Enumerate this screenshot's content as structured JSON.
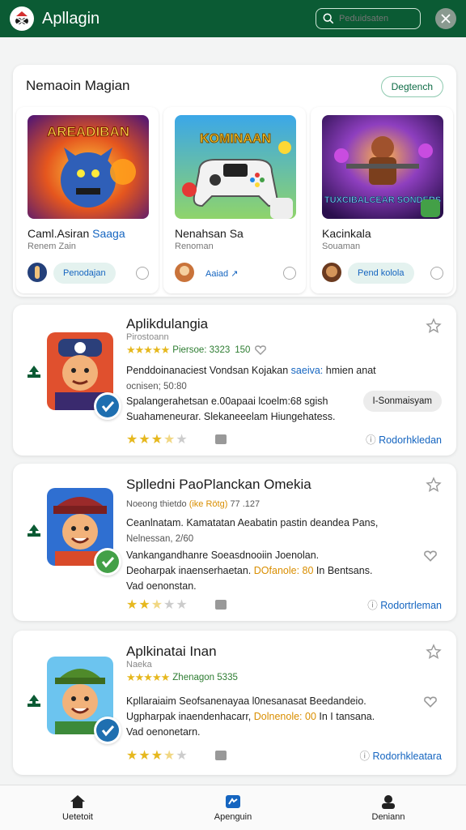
{
  "header": {
    "app_title": "Apllagin",
    "search_placeholder": "Peduidsaten"
  },
  "featured": {
    "title": "Nemaoin Magian",
    "more_label": "Degtench",
    "games": [
      {
        "name": "Caml.Asiran",
        "name_accent": "Saaga",
        "sub": "Renem Zain",
        "button": "Penodajan"
      },
      {
        "name": "Nenahsan Sa",
        "name_accent": "",
        "sub": "Renoman",
        "button": "Aaiad ↗"
      },
      {
        "name": "Kacinkala",
        "name_accent": "",
        "sub": "Souaman",
        "button": "Pend kolola"
      }
    ],
    "art_titles": [
      "AREADIBAN",
      "KOMINAAN",
      "TUXCIBALCEAR SONDERS"
    ]
  },
  "apps": [
    {
      "name": "Aplikdulangia",
      "dev": "Pirostoann",
      "rating_text": "Piersoe: 3323",
      "rating_extra": "150",
      "desc_line1_a": "Penddoinanaciest",
      "desc_line1_b": "Vondsan Kojakan",
      "desc_line1_c": "saeiva:",
      "desc_line1_d": "hmien anat",
      "desc_line2": "ocnisen; 50:80",
      "desc_line3": "Spalangerahetsan e.00apaai lcoelm:68 sgish",
      "desc_line4": "Suahameneurar. Slekaneeelam Hiungehatess.",
      "install_label": "I-Sonmaisyam",
      "more_link": "Rodorhkledan",
      "stars": 3.5
    },
    {
      "name": "Splledni PaoPlanckan Omekia",
      "dev": "Noeong thietdo",
      "dev_accent": "(ike Rötg)",
      "dev_extra": "77 .127",
      "desc_line1": "Ceanlnatam. Kamatatan Aeabatin pastin deandea Pans,",
      "desc_line2": "Nelnessan, 2/60",
      "desc_line3": "Vankangandhanre Soeasdnooiin Joenolan.",
      "desc_line4_a": "Deoharpak inaenserhaetan.",
      "desc_line4_b": "DOfanole: 80",
      "desc_line4_c": "In Bentsans.",
      "desc_line5": "Vad oenonstan.",
      "more_link": "Rodortrleman",
      "stars": 2.5
    },
    {
      "name": "Aplkinatai Inan",
      "dev": "Naeka",
      "rating_text": "Zhenagon 5335",
      "desc_line1": "Kpllaraiaim Seofsanenayaa l0nesanasat Beedandeio.",
      "desc_line2_a": "Ugpharpak inaendenhacarr,",
      "desc_line2_b": "Dolnenole: 00",
      "desc_line2_c": "In I tansana.",
      "desc_line3": "Vad oenonetarn.",
      "more_link": "Rodorhkleatara",
      "stars": 3.5
    }
  ],
  "bottom_nav": {
    "items": [
      "Uetetoit",
      "Apenguin",
      "Deniann"
    ]
  },
  "colors": {
    "header_bg": "#0b5b34",
    "link": "#1565c0",
    "star": "#e6b81e",
    "rating_green": "#2e7d32"
  }
}
